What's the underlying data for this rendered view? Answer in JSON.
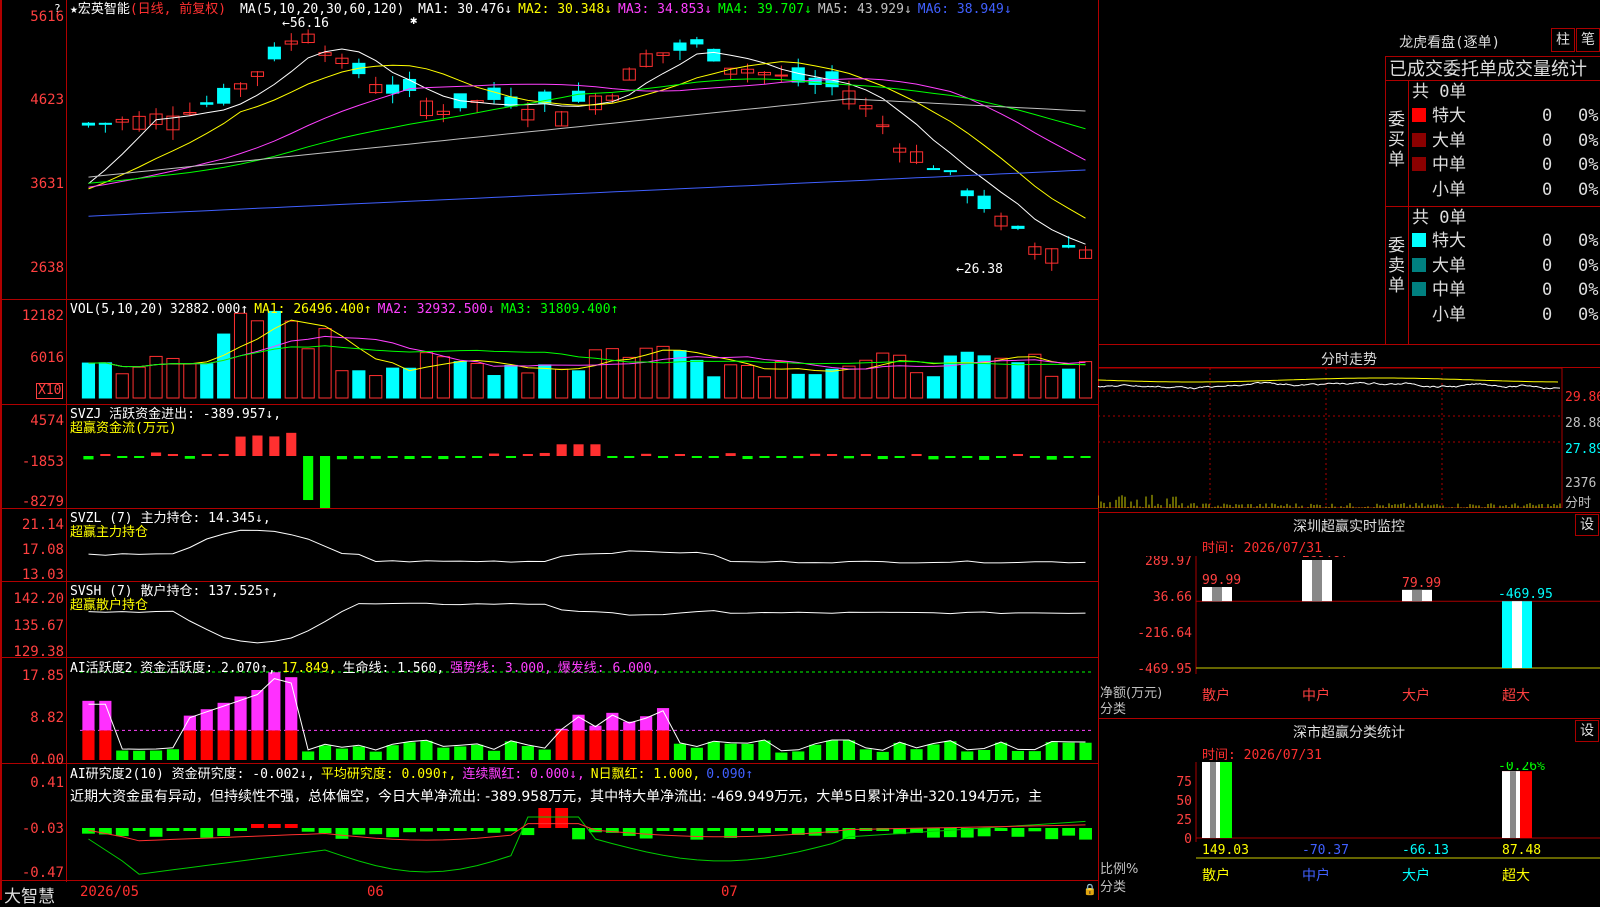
{
  "stock": {
    "name": "★宏英智能",
    "mode": "(日线, 前复权)",
    "ma_title": "MA(5,10,20,30,60,120)",
    "ma": [
      {
        "label": "MA1:",
        "value": "30.476",
        "arrow": "↓",
        "color": "#ffffff"
      },
      {
        "label": "MA2:",
        "value": "30.348",
        "arrow": "↓",
        "color": "#ffff00"
      },
      {
        "label": "MA3:",
        "value": "34.853",
        "arrow": "↓",
        "color": "#ff40ff"
      },
      {
        "label": "MA4:",
        "value": "39.707",
        "arrow": "↓",
        "color": "#00ff00"
      },
      {
        "label": "MA5:",
        "value": "43.929",
        "arrow": "↓",
        "color": "#c0c0c0"
      },
      {
        "label": "MA6:",
        "value": "38.949",
        "arrow": "↓",
        "color": "#4060ff"
      }
    ],
    "high_note": "←56.16",
    "low_note": "←26.38",
    "price_axis": [
      "5616",
      "4623",
      "3631",
      "2638"
    ]
  },
  "vol": {
    "title": "VOL(5,10,20)",
    "value": "32882.000↑",
    "ma1": "MA1: 26496.400↑",
    "ma2": "MA2: 32932.500↓",
    "ma3": "MA3: 31809.400↑",
    "axis": [
      "12182",
      "6016"
    ],
    "unit": "X10"
  },
  "svzj": {
    "title": "SVZJ  活跃资金进出: -389.957↓,",
    "sub": "超赢资金流(万元)",
    "axis": [
      "4574",
      "-1853",
      "-8279"
    ]
  },
  "svzl": {
    "title": "SVZL (7) 主力持仓: 14.345↓,",
    "sub": "超赢主力持仓",
    "axis": [
      "21.14",
      "17.08",
      "13.03"
    ]
  },
  "svsh": {
    "title": "SVSH (7) 散户持仓: 137.525↑,",
    "sub": "超赢散户持仓",
    "axis": [
      "142.20",
      "135.67",
      "129.38"
    ]
  },
  "ai1": {
    "title": "AI活跃度2 资金活跃度: 2.070↑,",
    "v2": "17.849,",
    "life": "生命线: 1.560,",
    "strong": "强势线: 3.000,",
    "burst": "爆发线: 6.000,",
    "axis": [
      "17.85",
      "8.82",
      "0.00"
    ]
  },
  "ai2": {
    "title": "AI研究度2(10) 资金研究度: -0.002↓,",
    "avg": "平均研究度: 0.090↑,",
    "red": "连续飘红: 0.000↓,",
    "nday": "N日飘红: 1.000,",
    "last": "0.090↑",
    "text": "近期大资金虽有异动，但持续性不强，总体偏空，今日大单净流出: -389.958万元，其中特大单净流出: -469.949万元，大单5日累计净出-320.194万元，主",
    "axis": [
      "0.41",
      "-0.03",
      "-0.47"
    ]
  },
  "xaxis": {
    "labels": [
      "2026/05",
      "06",
      "07"
    ],
    "brand": "大智慧"
  },
  "right": {
    "lhb_title": "龙虎看盘(逐单)",
    "btn1": "柱",
    "btn2": "笔",
    "stat_title": "已成交委托单成交量统计",
    "buy_label": "委买单",
    "sell_label": "委卖单",
    "buy_total": "共 0单",
    "sell_total": "共 0单",
    "rows": [
      "特大",
      "大单",
      "中单",
      "小单"
    ],
    "zero": "0",
    "pct": "0%",
    "buy_colors": [
      "#ff0000",
      "#8b0000",
      "#8b0000",
      ""
    ],
    "sell_colors": [
      "#00ffff",
      "#008080",
      "#008080",
      ""
    ],
    "fs_title": "分时走势",
    "fs_axis": [
      "29.86",
      "28.88",
      "27.89"
    ],
    "fs_vol": "2376",
    "fs_unit": "分时",
    "sz_title": "深圳超赢实时监控",
    "sz_btn": "设",
    "sz_time": "时间: 2026/07/31",
    "sz_axis": [
      "289.97",
      "36.66",
      "-216.64",
      "-469.95"
    ],
    "sz_bars": [
      {
        "name": "散户",
        "value": 99.99,
        "label": "99.99"
      },
      {
        "name": "中户",
        "value": 289.97,
        "label": "289.97"
      },
      {
        "name": "大户",
        "value": 79.99,
        "label": "79.99"
      },
      {
        "name": "超大",
        "value": -469.95,
        "label": "-469.95"
      }
    ],
    "sz_ylab": "净额(万元)",
    "sz_xlab": "分类",
    "cls_title": "深市超赢分类统计",
    "cls_btn": "设",
    "cls_time": "时间: 2026/07/31",
    "cls_axis": [
      "75",
      "50",
      "25",
      "0"
    ],
    "cls_ylab": "比例%",
    "cls_xlab": "分类",
    "cls_vals": [
      "149.03",
      "-70.37",
      "-66.13",
      "87.48"
    ],
    "cls_top": "-0.26%",
    "cls_names": [
      "散户",
      "中户",
      "大户",
      "超大"
    ]
  }
}
